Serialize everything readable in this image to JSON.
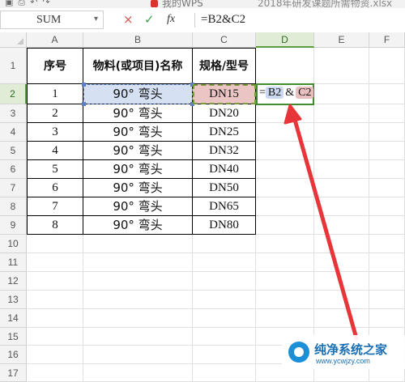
{
  "titlebar": {
    "doc1": "我的WPS",
    "doc2": "2018年研发课题所需物资.xlsx"
  },
  "formula_bar": {
    "name_box": "SUM",
    "cancel_icon": "×",
    "confirm_icon": "✓",
    "fx_label": "fx",
    "formula": "=B2&C2"
  },
  "columns": [
    "A",
    "B",
    "C",
    "D",
    "E",
    "F"
  ],
  "rows": [
    "1",
    "2",
    "3",
    "4",
    "5",
    "6",
    "7",
    "8",
    "9",
    "10",
    "11",
    "12",
    "13",
    "14",
    "15",
    "16",
    "17"
  ],
  "table": {
    "headers": [
      "序号",
      "物料(或项目)名称",
      "规格/型号"
    ],
    "rows": [
      {
        "no": "1",
        "name": "90° 弯头",
        "spec": "DN15"
      },
      {
        "no": "2",
        "name": "90° 弯头",
        "spec": "DN20"
      },
      {
        "no": "3",
        "name": "90° 弯头",
        "spec": "DN25"
      },
      {
        "no": "4",
        "name": "90° 弯头",
        "spec": "DN32"
      },
      {
        "no": "5",
        "name": "90° 弯头",
        "spec": "DN40"
      },
      {
        "no": "6",
        "name": "90° 弯头",
        "spec": "DN50"
      },
      {
        "no": "7",
        "name": "90° 弯头",
        "spec": "DN65"
      },
      {
        "no": "8",
        "name": "90° 弯头",
        "spec": "DN80"
      }
    ]
  },
  "active_cell": {
    "col": "D",
    "row": "2",
    "edit_parts": [
      "=",
      "B2",
      "&",
      "C2"
    ]
  },
  "watermark": {
    "title": "纯净系统之家",
    "url": "www.ycwjzy.com"
  },
  "colors": {
    "ref_b2": "#d5e1f2",
    "ref_c2": "#ebc4c4",
    "active_border": "#3f8d2c",
    "arrow": "#e8353a"
  }
}
